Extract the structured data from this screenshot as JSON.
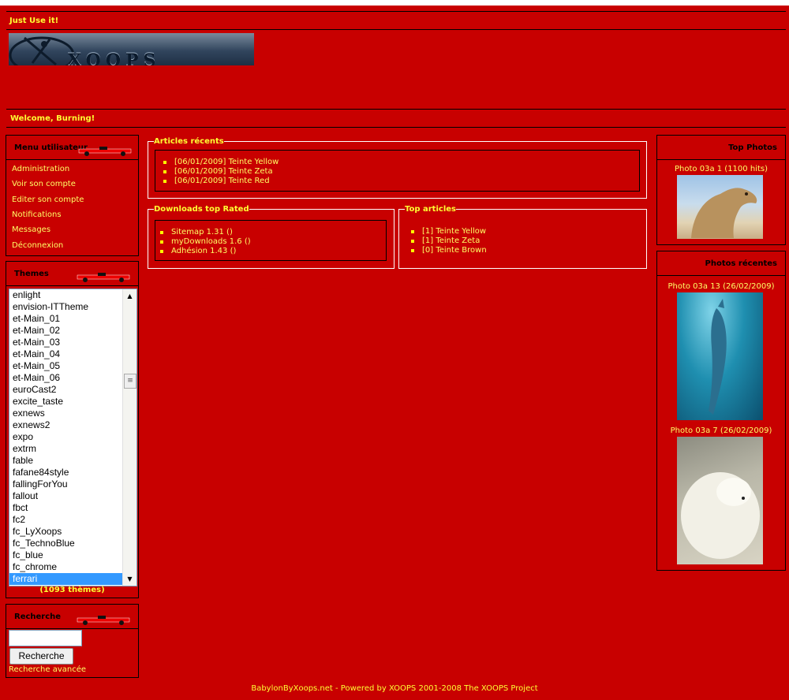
{
  "header": {
    "slogan": "Just Use it!",
    "logo_text": "XOOPS BRASIL",
    "welcome": "Welcome, Burning!"
  },
  "user_menu": {
    "title": "Menu utilisateur",
    "items": [
      "Administration",
      "Voir son compte",
      "Editer son compte",
      "Notifications",
      "Messages",
      "Déconnexion"
    ]
  },
  "themes": {
    "title": "Themes",
    "options": [
      "enlight",
      "envision-ITTheme",
      "et-Main_01",
      "et-Main_02",
      "et-Main_03",
      "et-Main_04",
      "et-Main_05",
      "et-Main_06",
      "euroCast2",
      "excite_taste",
      "exnews",
      "exnews2",
      "expo",
      "extrm",
      "fable",
      "fafane84style",
      "fallingForYou",
      "fallout",
      "fbct",
      "fc2",
      "fc_LyXoops",
      "fc_TechnoBlue",
      "fc_blue",
      "fc_chrome",
      "ferrari"
    ],
    "selected": "ferrari",
    "count": "(1093 thèmes)"
  },
  "search": {
    "title": "Recherche",
    "button": "Recherche",
    "advanced": "Recherche avancée"
  },
  "articles_recents": {
    "title": "Articles récents",
    "items": [
      "[06/01/2009] Teinte Yellow",
      "[06/01/2009] Teinte Zeta",
      "[06/01/2009] Teinte Red"
    ]
  },
  "downloads": {
    "title": "Downloads top Rated",
    "items": [
      "Sitemap 1.31 ()",
      "myDownloads 1.6 ()",
      "Adhésion 1.43 ()"
    ]
  },
  "top_articles": {
    "title": "Top articles",
    "items": [
      "[1] Teinte Yellow",
      "[1] Teinte Zeta",
      "[0] Teinte Brown"
    ]
  },
  "top_photos": {
    "title": "Top Photos",
    "caption": "Photo 03a 1 (1100 hits)"
  },
  "recent_photos": {
    "title": "Photos récentes",
    "captions": [
      "Photo 03a 13 (26/02/2009)",
      "Photo 03a 7 (26/02/2009)"
    ]
  },
  "footer": "BabylonByXoops.net - Powered by XOOPS 2001-2008 The XOOPS Project",
  "colors": {
    "background": "#c80000",
    "link": "#ffff66",
    "title": "#000000"
  }
}
